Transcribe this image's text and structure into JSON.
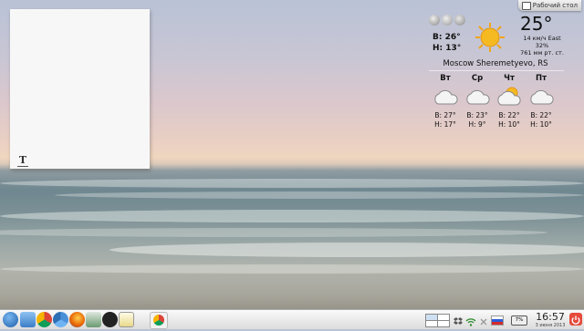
{
  "desktop": {
    "toolbox_label": "Рабочий стол"
  },
  "note": {
    "tool_glyph": "T"
  },
  "weather": {
    "current_temp": "25°",
    "wind": "14 км/ч East",
    "humidity": "32%",
    "pressure": "761 мм рт. ст.",
    "high": "В: 26°",
    "low": "Н: 13°",
    "location": "Moscow Sheremetyevo, RS",
    "forecast": [
      {
        "day": "Вт",
        "icon": "cloud-icon",
        "high": "В: 27°",
        "low": "Н: 17°"
      },
      {
        "day": "Ср",
        "icon": "cloud-icon",
        "high": "В: 23°",
        "low": "Н: 9°"
      },
      {
        "day": "Чт",
        "icon": "sun-cloud-icon",
        "high": "В: 22°",
        "low": "Н: 10°"
      },
      {
        "day": "Пт",
        "icon": "cloud-icon",
        "high": "В: 22°",
        "low": "Н: 10°"
      }
    ]
  },
  "taskbar": {
    "launchers": [
      "kde-menu-icon",
      "file-manager-icon",
      "chrome-icon",
      "chromium-icon",
      "firefox-icon",
      "skype-icon",
      "font-manager-icon",
      "text-editor-icon",
      "chrome-window-icon"
    ],
    "battery": "7%",
    "clock_time": "16:57",
    "clock_date": "3 июня 2013"
  },
  "colors": {
    "accent": "#e54a3c",
    "sun": "#f5b921"
  }
}
